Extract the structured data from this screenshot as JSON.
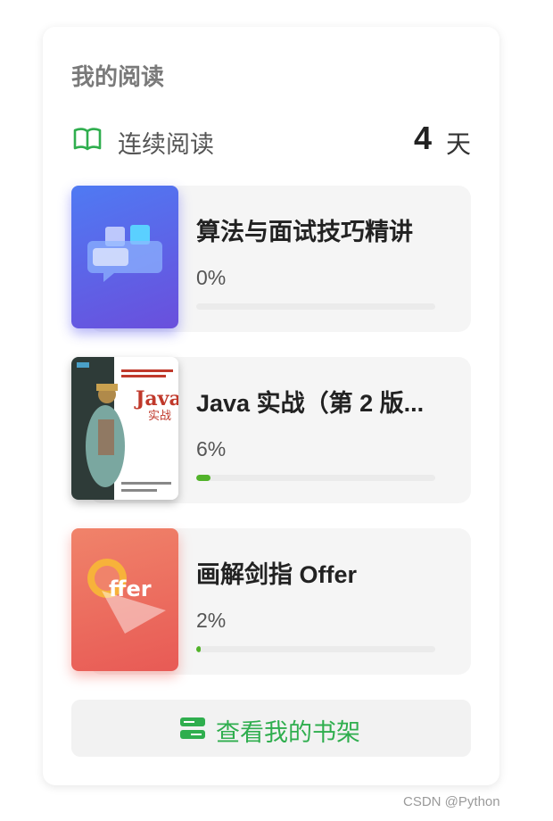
{
  "card": {
    "title": "我的阅读"
  },
  "streak": {
    "icon": "open-book-icon",
    "label": "连续阅读",
    "count": "4",
    "unit": "天"
  },
  "books": [
    {
      "title": "算法与面试技巧精讲",
      "percent_text": "0%",
      "progress": 0,
      "cover": "chat-bubbles-cover"
    },
    {
      "title": "Java 实战（第 2 版...",
      "percent_text": "6%",
      "progress": 6,
      "cover": "java-book-cover",
      "cover_text": "Java",
      "cover_subtext": "实战"
    },
    {
      "title": "画解剑指 Offer",
      "percent_text": "2%",
      "progress": 2,
      "cover": "offer-book-cover",
      "cover_text": "ffer"
    }
  ],
  "shelf_button": {
    "icon": "bookshelf-icon",
    "label": "查看我的书架"
  },
  "watermark": "CSDN @Python",
  "colors": {
    "accent_green": "#2fae4e",
    "progress_green": "#52b32a",
    "panel_bg": "#f5f5f5"
  }
}
